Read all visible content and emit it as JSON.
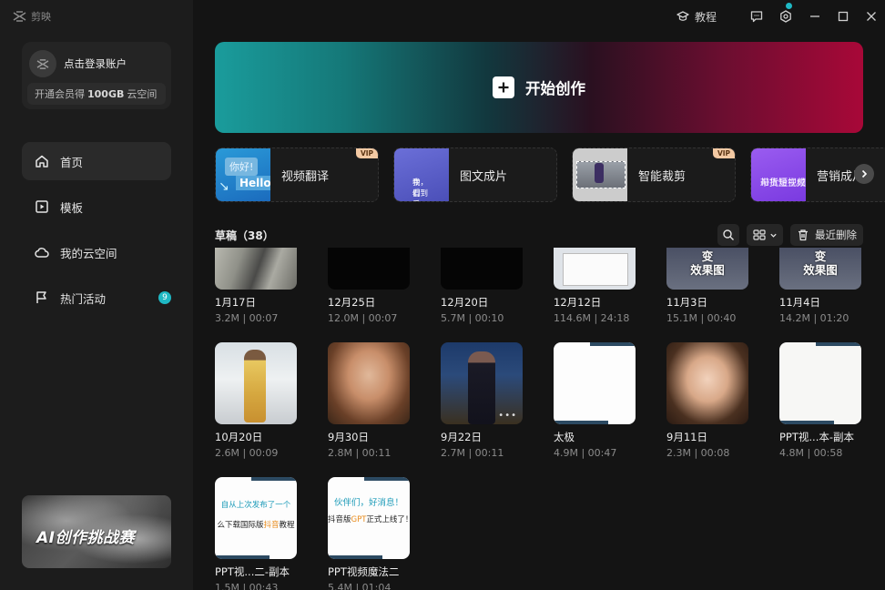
{
  "app": {
    "name": "剪映"
  },
  "login": {
    "label": "点击登录账户",
    "vip_pre": "开通会员得",
    "vip_bold": "100GB",
    "vip_post": "云空间"
  },
  "nav": [
    {
      "label": "首页",
      "icon": "home-icon"
    },
    {
      "label": "模板",
      "icon": "template-icon"
    },
    {
      "label": "我的云空间",
      "icon": "cloud-icon"
    },
    {
      "label": "热门活动",
      "icon": "flag-icon",
      "badge": "9"
    }
  ],
  "promo": {
    "title": "AI创作挑战赛"
  },
  "topbar": {
    "tutorial": "教程"
  },
  "hero": {
    "label": "开始创作"
  },
  "tools": [
    {
      "label": "视频翻译",
      "vip": "VIP",
      "thumb_a": "你好!",
      "thumb_b": "Hello"
    },
    {
      "label": "图文成片",
      "thumb_a": "我们乘车途",
      "thumb_b": "中，看到"
    },
    {
      "label": "智能裁剪",
      "vip": "VIP"
    },
    {
      "label": "营销成片",
      "thumb_a": "AI批量生成",
      "thumb_b": "带货短视频"
    }
  ],
  "drafts": {
    "title": "草稿（38）",
    "trash_label": "最近删除",
    "items": [
      {
        "name": "1月17日",
        "meta": "3.2M | 00:07"
      },
      {
        "name": "12月25日",
        "meta": "12.0M | 00:07"
      },
      {
        "name": "12月20日",
        "meta": "5.7M | 00:10"
      },
      {
        "name": "12月12日",
        "meta": "114.6M | 24:18"
      },
      {
        "name": "11月3日",
        "meta": "15.1M | 00:40",
        "poster_a": "变",
        "poster_b": "效果图"
      },
      {
        "name": "11月4日",
        "meta": "14.2M | 01:20",
        "poster_a": "变",
        "poster_b": "效果图"
      },
      {
        "name": "10月20日",
        "meta": "2.6M | 00:09"
      },
      {
        "name": "9月30日",
        "meta": "2.8M | 00:11"
      },
      {
        "name": "9月22日",
        "meta": "2.7M | 00:11",
        "more": "•••"
      },
      {
        "name": "太极",
        "meta": "4.9M | 00:47"
      },
      {
        "name": "9月11日",
        "meta": "2.3M | 00:08"
      },
      {
        "name": "PPT视...本-副本",
        "meta": "4.8M | 00:58"
      },
      {
        "name": "PPT视...二-副本",
        "meta": "1.5M | 00:43",
        "ppt_a": "自从上次发布了一个",
        "ppt_b1": "么下载国际版",
        "ppt_bh": "抖音",
        "ppt_b2": "教程"
      },
      {
        "name": "PPT视频魔法二",
        "meta": "5.4M | 01:04",
        "ppt_a": "伙伴们，好消息！",
        "ppt_b1": "抖音版",
        "ppt_bh": "GPT",
        "ppt_b2": "正式上线了！"
      }
    ]
  },
  "colors": {
    "accent": "#1fb8c4",
    "vip": "#f3c9a3",
    "bg": "#141414",
    "sidebar": "#1c1c1c"
  }
}
